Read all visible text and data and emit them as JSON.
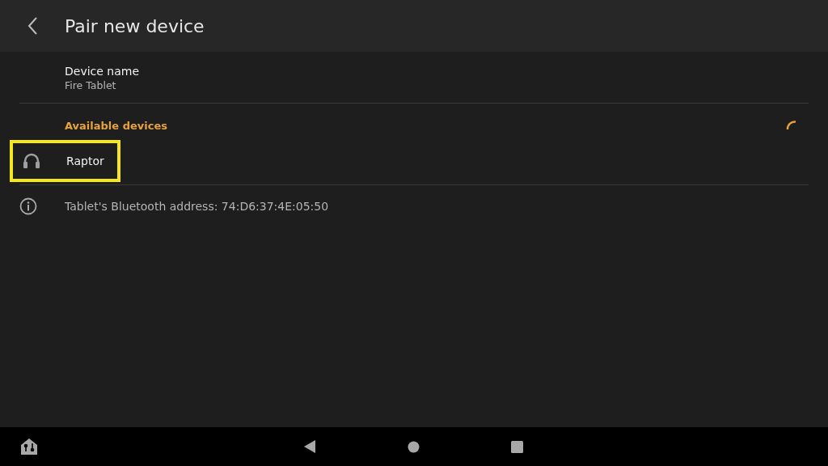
{
  "header": {
    "title": "Pair new device"
  },
  "device_name": {
    "label": "Device name",
    "value": "Fire Tablet"
  },
  "available": {
    "label": "Available devices",
    "searching": true
  },
  "devices": [
    {
      "name": "Raptor",
      "highlighted": true
    }
  ],
  "info": {
    "text": "Tablet's Bluetooth address: 74:D6:37:4E:05:50"
  }
}
